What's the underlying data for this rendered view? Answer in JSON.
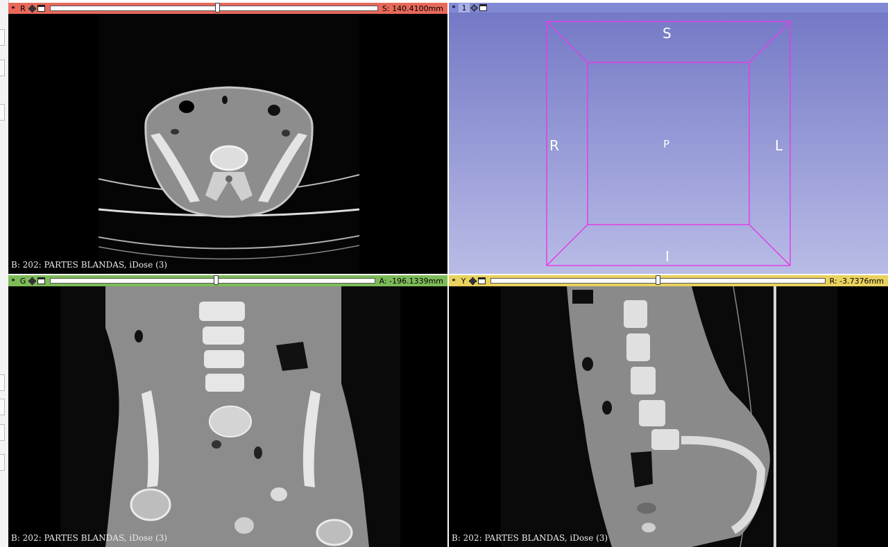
{
  "views": {
    "red": {
      "label": "R",
      "offset": "S: 140.4100mm",
      "slider_position": 0.51,
      "caption": "B: 202: PARTES BLANDAS, iDose (3)",
      "color": "#e8695a"
    },
    "threed": {
      "label": "1",
      "color": "#8089d4",
      "orientation": {
        "top": "S",
        "bottom": "I",
        "left": "R",
        "right": "L",
        "center": "P"
      }
    },
    "green": {
      "label": "G",
      "offset": "A: -196.1339mm",
      "slider_position": 0.51,
      "caption": "B: 202: PARTES BLANDAS, iDose (3)",
      "color": "#7dbb58"
    },
    "yellow": {
      "label": "Y",
      "offset": "R: -3.7376mm",
      "slider_position": 0.5,
      "caption": "B: 202: PARTES BLANDAS, iDose (3)",
      "color": "#e9d25e"
    }
  },
  "icons": [
    "pin-icon",
    "link-icon",
    "maximize-icon",
    "gear-icon"
  ]
}
